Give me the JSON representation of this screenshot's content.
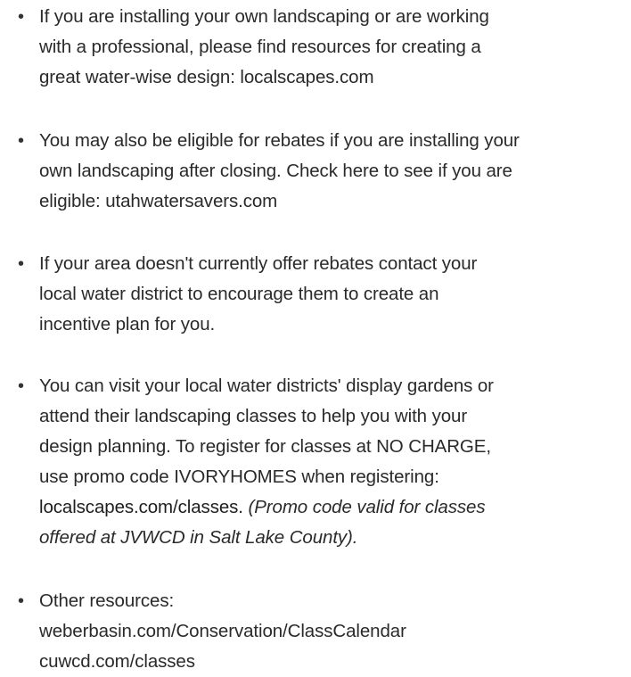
{
  "bullet_char": "•",
  "items": [
    {
      "lines": [
        "If you are installing your own landscaping or are working",
        "with a professional, please find resources for creating a",
        "great water-wise design: localscapes.com"
      ]
    },
    {
      "lines": [
        "You may also be eligible for rebates if you are installing your",
        "own landscaping after closing. Check here to see if you are",
        "eligible: utahwatersavers.com"
      ]
    },
    {
      "lines": [
        "If your area doesn't currently offer rebates contact your",
        "local water district to encourage them to create an",
        "incentive plan for you."
      ]
    },
    {
      "lines": [
        "You can visit your local water districts' display gardens or",
        "attend their landscaping classes to help you with your",
        "design planning. To register for classes at NO CHARGE,",
        "use promo code IVORYHOMES when registering:"
      ],
      "link_line": "localscapes.com/classes.",
      "italic_after_link": "(Promo code valid for classes",
      "italic_line": "offered at JVWCD in Salt Lake County)."
    },
    {
      "lines": [
        "Other resources:",
        "weberbasin.com/Conservation/ClassCalendar",
        "cuwcd.com/classes"
      ]
    }
  ]
}
